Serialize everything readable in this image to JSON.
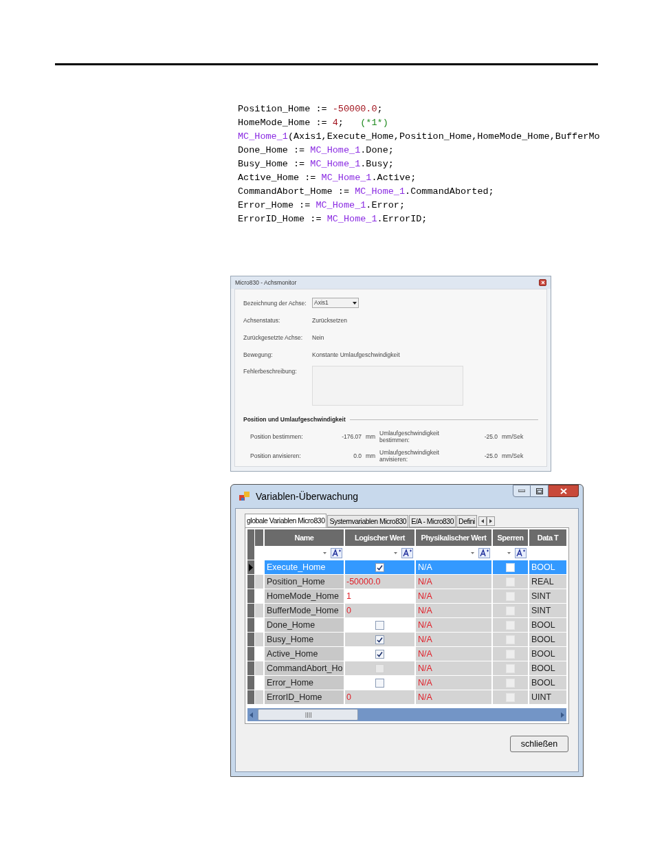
{
  "code": {
    "lines": [
      [
        {
          "kind": "plain",
          "text": "Position_Home := "
        },
        {
          "kind": "number",
          "text": "-50000.0"
        },
        {
          "kind": "plain",
          "text": ";"
        }
      ],
      [
        {
          "kind": "plain",
          "text": "HomeMode_Home := "
        },
        {
          "kind": "number",
          "text": "4"
        },
        {
          "kind": "plain",
          "text": ";   "
        },
        {
          "kind": "comment",
          "text": "(*1*)"
        }
      ],
      [
        {
          "kind": "block",
          "text": "MC_Home_1"
        },
        {
          "kind": "plain",
          "text": "(Axis1,Execute_Home,Position_Home,HomeMode_Home,BufferMo"
        }
      ],
      [
        {
          "kind": "plain",
          "text": "Done_Home := "
        },
        {
          "kind": "block",
          "text": "MC_Home_1"
        },
        {
          "kind": "plain",
          "text": ".Done;"
        }
      ],
      [
        {
          "kind": "plain",
          "text": "Busy_Home := "
        },
        {
          "kind": "block",
          "text": "MC_Home_1"
        },
        {
          "kind": "plain",
          "text": ".Busy;"
        }
      ],
      [
        {
          "kind": "plain",
          "text": "Active_Home := "
        },
        {
          "kind": "block",
          "text": "MC_Home_1"
        },
        {
          "kind": "plain",
          "text": ".Active;"
        }
      ],
      [
        {
          "kind": "plain",
          "text": "CommandAbort_Home := "
        },
        {
          "kind": "block",
          "text": "MC_Home_1"
        },
        {
          "kind": "plain",
          "text": ".CommandAborted;"
        }
      ],
      [
        {
          "kind": "plain",
          "text": "Error_Home := "
        },
        {
          "kind": "block",
          "text": "MC_Home_1"
        },
        {
          "kind": "plain",
          "text": ".Error;"
        }
      ],
      [
        {
          "kind": "plain",
          "text": "ErrorID_Home := "
        },
        {
          "kind": "block",
          "text": "MC_Home_1"
        },
        {
          "kind": "plain",
          "text": ".ErrorID;"
        }
      ]
    ]
  },
  "axis_monitor": {
    "title": "Micro830 - Achsmonitor",
    "fields": [
      {
        "label": "Bezeichnung der Achse:",
        "kind": "select",
        "value": "Axis1"
      },
      {
        "label": "Achsenstatus:",
        "kind": "text",
        "value": "Zurücksetzen"
      },
      {
        "label": "Zurückgesetzte Achse:",
        "kind": "text",
        "value": "Nein"
      },
      {
        "label": "Bewegung:",
        "kind": "text",
        "value": "Konstante Umlaufgeschwindigkeit"
      },
      {
        "label": "Fehlerbeschreibung:",
        "kind": "box"
      }
    ],
    "section": {
      "title": "Position und Umlaufgeschwindigkeit",
      "rows": [
        [
          {
            "label": "Position bestimmen:",
            "value": "-176.07",
            "unit": "mm"
          },
          {
            "label": "Umlaufgeschwindigkeit bestimmen:",
            "value": "-25.0",
            "unit": "mm/Sek"
          }
        ],
        [
          {
            "label": "Position anvisieren:",
            "value": "0.0",
            "unit": "mm"
          },
          {
            "label": "Umlaufgeschwindigkeit anvisieren:",
            "value": "-25.0",
            "unit": "mm/Sek"
          }
        ]
      ]
    }
  },
  "variable_monitor": {
    "title": "Variablen-Überwachung",
    "tabs": [
      {
        "label": "globale Variablen Micro830",
        "selected": true
      },
      {
        "label": "Systemvariablen Micro830",
        "selected": false
      },
      {
        "label": "E/A - Micro830",
        "selected": false
      },
      {
        "label": "Defini",
        "selected": false
      }
    ],
    "columns": [
      "Name",
      "Logischer Wert",
      "Physikalischer Wert",
      "Sperren",
      "Data T"
    ],
    "rows": [
      {
        "name": "Execute_Home",
        "selected": true,
        "logical": {
          "kind": "check",
          "checked": true,
          "disabled": false
        },
        "physical": "N/A",
        "locked": false,
        "type": "BOOL"
      },
      {
        "name": "Position_Home",
        "selected": false,
        "logical": {
          "kind": "text",
          "text": "-50000.0"
        },
        "physical": "N/A",
        "locked": false,
        "type": "REAL"
      },
      {
        "name": "HomeMode_Home",
        "selected": false,
        "logical": {
          "kind": "text",
          "text": "1"
        },
        "physical": "N/A",
        "locked": false,
        "type": "SINT"
      },
      {
        "name": "BufferMode_Home",
        "selected": false,
        "logical": {
          "kind": "text",
          "text": "0"
        },
        "physical": "N/A",
        "locked": false,
        "type": "SINT"
      },
      {
        "name": "Done_Home",
        "selected": false,
        "logical": {
          "kind": "check",
          "checked": false,
          "disabled": false
        },
        "physical": "N/A",
        "locked": false,
        "type": "BOOL"
      },
      {
        "name": "Busy_Home",
        "selected": false,
        "logical": {
          "kind": "check",
          "checked": true,
          "disabled": false
        },
        "physical": "N/A",
        "locked": false,
        "type": "BOOL"
      },
      {
        "name": "Active_Home",
        "selected": false,
        "logical": {
          "kind": "check",
          "checked": true,
          "disabled": false
        },
        "physical": "N/A",
        "locked": false,
        "type": "BOOL"
      },
      {
        "name": "CommandAbort_Ho",
        "selected": false,
        "logical": {
          "kind": "check",
          "checked": false,
          "disabled": true
        },
        "physical": "N/A",
        "locked": false,
        "type": "BOOL"
      },
      {
        "name": "Error_Home",
        "selected": false,
        "logical": {
          "kind": "check",
          "checked": false,
          "disabled": false
        },
        "physical": "N/A",
        "locked": false,
        "type": "BOOL"
      },
      {
        "name": "ErrorID_Home",
        "selected": false,
        "logical": {
          "kind": "text",
          "text": "0"
        },
        "physical": "N/A",
        "locked": false,
        "type": "UINT"
      }
    ],
    "close_button": "schließen"
  }
}
